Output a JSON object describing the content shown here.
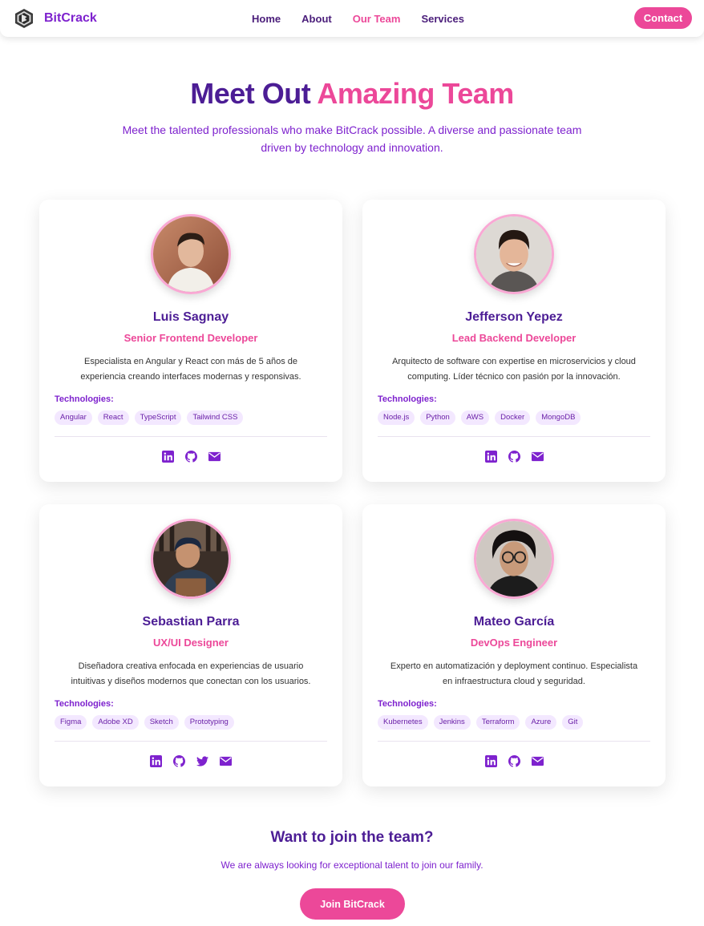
{
  "brand": {
    "name": "BitCrack",
    "logo_icon": "bitcrack-logo-icon"
  },
  "nav": {
    "links": [
      "Home",
      "About",
      "Our Team",
      "Services"
    ],
    "active": "Our Team",
    "contact_label": "Contact"
  },
  "hero": {
    "title_part1": "Meet Out",
    "title_part2": "Amazing Team",
    "subtitle": "Meet the talented professionals who make BitCrack possible. A diverse and passionate team driven by technology and innovation."
  },
  "tech_label": "Technologies:",
  "members": [
    {
      "name": "Luis Sagnay",
      "role": "Senior Frontend Developer",
      "description": "Especialista en Angular y React con más de 5 años de experiencia creando interfaces modernas y responsivas.",
      "technologies": [
        "Angular",
        "React",
        "TypeScript",
        "Tailwind CSS"
      ],
      "socials": [
        "linkedin-icon",
        "github-icon",
        "email-icon"
      ]
    },
    {
      "name": "Jefferson Yepez",
      "role": "Lead Backend Developer",
      "description": "Arquitecto de software con expertise en microservicios y cloud computing. Líder técnico con pasión por la innovación.",
      "technologies": [
        "Node.js",
        "Python",
        "AWS",
        "Docker",
        "MongoDB"
      ],
      "socials": [
        "linkedin-icon",
        "github-icon",
        "email-icon"
      ]
    },
    {
      "name": "Sebastian Parra",
      "role": "UX/UI Designer",
      "description": "Diseñadora creativa enfocada en experiencias de usuario intuitivas y diseños modernos que conectan con los usuarios.",
      "technologies": [
        "Figma",
        "Adobe XD",
        "Sketch",
        "Prototyping"
      ],
      "socials": [
        "linkedin-icon",
        "github-icon",
        "twitter-icon",
        "email-icon"
      ]
    },
    {
      "name": "Mateo García",
      "role": "DevOps Engineer",
      "description": "Experto en automatización y deployment continuo. Especialista en infraestructura cloud y seguridad.",
      "technologies": [
        "Kubernetes",
        "Jenkins",
        "Terraform",
        "Azure",
        "Git"
      ],
      "socials": [
        "linkedin-icon",
        "github-icon",
        "email-icon"
      ]
    }
  ],
  "cta": {
    "title": "Want to join the team?",
    "subtitle": "We are always looking for exceptional talent to join our family.",
    "button": "Join BitCrack"
  },
  "colors": {
    "accent_pink": "#ec4899",
    "brand_purple": "#7e22ce",
    "heading_purple": "#4c1d95",
    "chip_bg": "#f3e8ff"
  }
}
